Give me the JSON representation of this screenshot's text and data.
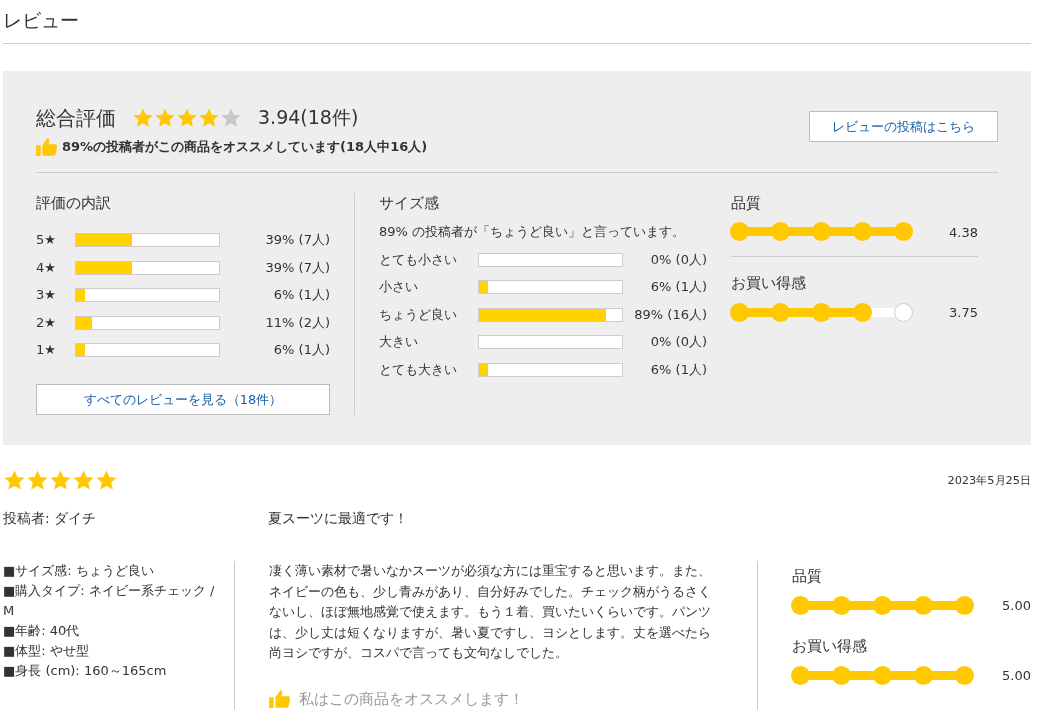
{
  "heading": "レビュー",
  "summary": {
    "title": "総合評価",
    "stars": 4,
    "score": "3.94(18件)",
    "recommend": "89%の投稿者がこの商品をオススメしています(18人中16人)",
    "post_button": "レビューの投稿はこちら"
  },
  "breakdown": {
    "title": "評価の内訳",
    "rows": [
      {
        "label": "5★",
        "level": 0.39,
        "reading": "39% (7人)"
      },
      {
        "label": "4★",
        "level": 0.39,
        "reading": "39% (7人)"
      },
      {
        "label": "3★",
        "level": 0.06,
        "reading": "6% (1人)"
      },
      {
        "label": "2★",
        "level": 0.11,
        "reading": "11% (2人)"
      },
      {
        "label": "1★",
        "level": 0.06,
        "reading": "6% (1人)"
      }
    ],
    "all_button": "すべてのレビューを見る（18件）"
  },
  "size": {
    "title": "サイズ感",
    "note": "89% の投稿者が「ちょうど良い」と言っています。",
    "rows": [
      {
        "label": "とても小さい",
        "level": 0,
        "reading": "0% (0人)"
      },
      {
        "label": "小さい",
        "level": 0.06,
        "reading": "6% (1人)"
      },
      {
        "label": "ちょうど良い",
        "level": 0.89,
        "reading": "89% (16人)"
      },
      {
        "label": "大きい",
        "level": 0,
        "reading": "0% (0人)"
      },
      {
        "label": "とても大きい",
        "level": 0.06,
        "reading": "6% (1人)"
      }
    ]
  },
  "meters": [
    {
      "label": "品質",
      "level": 1,
      "reading": "4.38"
    },
    {
      "label": "お買い得感",
      "level": 0.8,
      "reading": "3.75"
    }
  ],
  "review": {
    "stars": 5,
    "date": "2023年5月25日",
    "author": "投稿者: ダイチ",
    "title": "夏スーツに最適です！",
    "attributes": [
      "■サイズ感: ちょうど良い",
      "■購入タイプ: ネイビー系チェック / M",
      "■年齢: 40代",
      "■体型: やせ型",
      "■身長 (cm): 160～165cm"
    ],
    "body": "凄く薄い素材で暑いなかスーツが必須な方には重宝すると思います。また、ネイビーの色も、少し青みがあり、自分好みでした。チェック柄がうるさくないし、ほぼ無地感覚で使えます。もう１着、買いたいくらいです。パンツは、少し丈は短くなりますが、暑い夏ですし、ヨシとします。丈を選べたら尚ヨシですが、コスパで言っても文句なしでした。",
    "recommend": "私はこの商品をオススメします！",
    "meters": [
      {
        "label": "品質",
        "level": 1,
        "reading": "5.00"
      },
      {
        "label": "お買い得感",
        "level": 1,
        "reading": "5.00"
      }
    ]
  }
}
